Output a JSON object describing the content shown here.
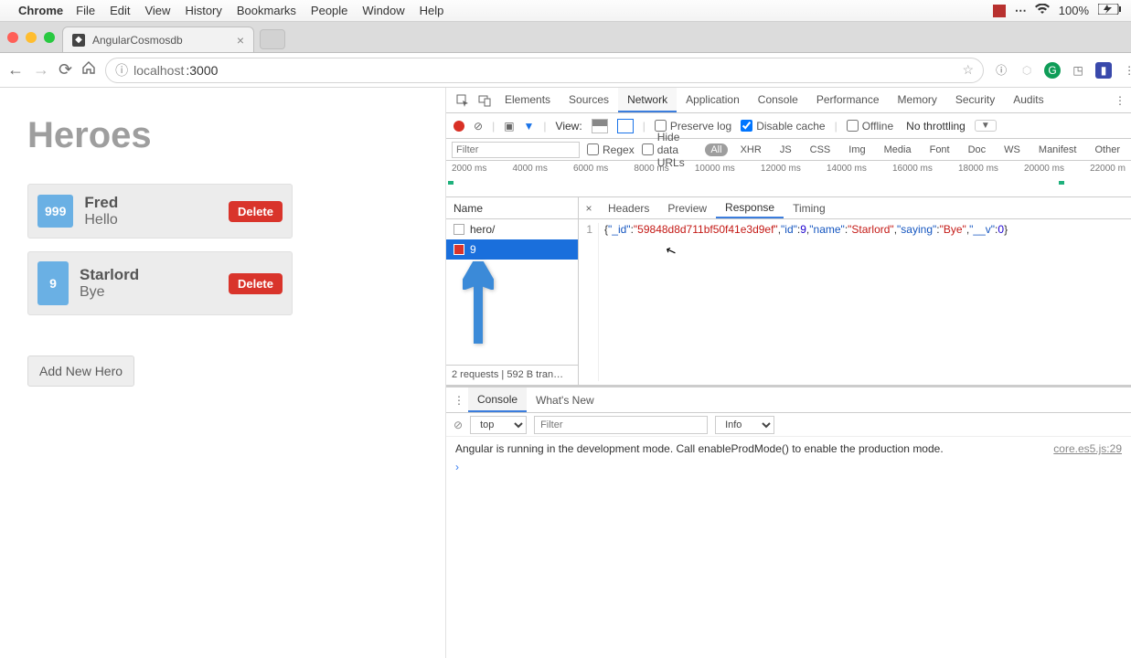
{
  "menubar": {
    "app": "Chrome",
    "items": [
      "File",
      "Edit",
      "View",
      "History",
      "Bookmarks",
      "People",
      "Window",
      "Help"
    ],
    "battery": "100%"
  },
  "tab": {
    "title": "AngularCosmosdb"
  },
  "url": {
    "host": "localhost",
    "port": ":3000"
  },
  "page": {
    "title": "Heroes",
    "heroes": [
      {
        "id": "999",
        "name": "Fred",
        "saying": "Hello",
        "delete": "Delete"
      },
      {
        "id": "9",
        "name": "Starlord",
        "saying": "Bye",
        "delete": "Delete"
      }
    ],
    "add": "Add New Hero"
  },
  "devtools": {
    "tabs": [
      "Elements",
      "Sources",
      "Network",
      "Application",
      "Console",
      "Performance",
      "Memory",
      "Security",
      "Audits"
    ],
    "activeTab": "Network",
    "toolbar": {
      "viewLabel": "View:",
      "preserve": "Preserve log",
      "disableCache": "Disable cache",
      "offline": "Offline",
      "throttling": "No throttling"
    },
    "filter": {
      "placeholder": "Filter",
      "regex": "Regex",
      "hideData": "Hide data URLs",
      "types": [
        "All",
        "XHR",
        "JS",
        "CSS",
        "Img",
        "Media",
        "Font",
        "Doc",
        "WS",
        "Manifest",
        "Other"
      ]
    },
    "timeline": [
      "2000 ms",
      "4000 ms",
      "6000 ms",
      "8000 ms",
      "10000 ms",
      "12000 ms",
      "14000 ms",
      "16000 ms",
      "18000 ms",
      "20000 ms",
      "22000 m"
    ],
    "requests": {
      "header": "Name",
      "rows": [
        {
          "name": "hero/"
        },
        {
          "name": "9"
        }
      ],
      "status": "2 requests | 592 B tran…"
    },
    "detail": {
      "tabs": [
        "Headers",
        "Preview",
        "Response",
        "Timing"
      ],
      "lineNo": "1",
      "json": {
        "_id": "59848d8d711bf50f41e3d9ef",
        "id": 9,
        "name": "Starlord",
        "saying": "Bye",
        "__v": 0
      }
    },
    "drawer": {
      "tabs": [
        "Console",
        "What's New"
      ],
      "context": "top",
      "filterPlaceholder": "Filter",
      "level": "Info",
      "message": "Angular is running in the development mode. Call enableProdMode() to enable the production mode.",
      "source": "core.es5.js:29"
    }
  }
}
